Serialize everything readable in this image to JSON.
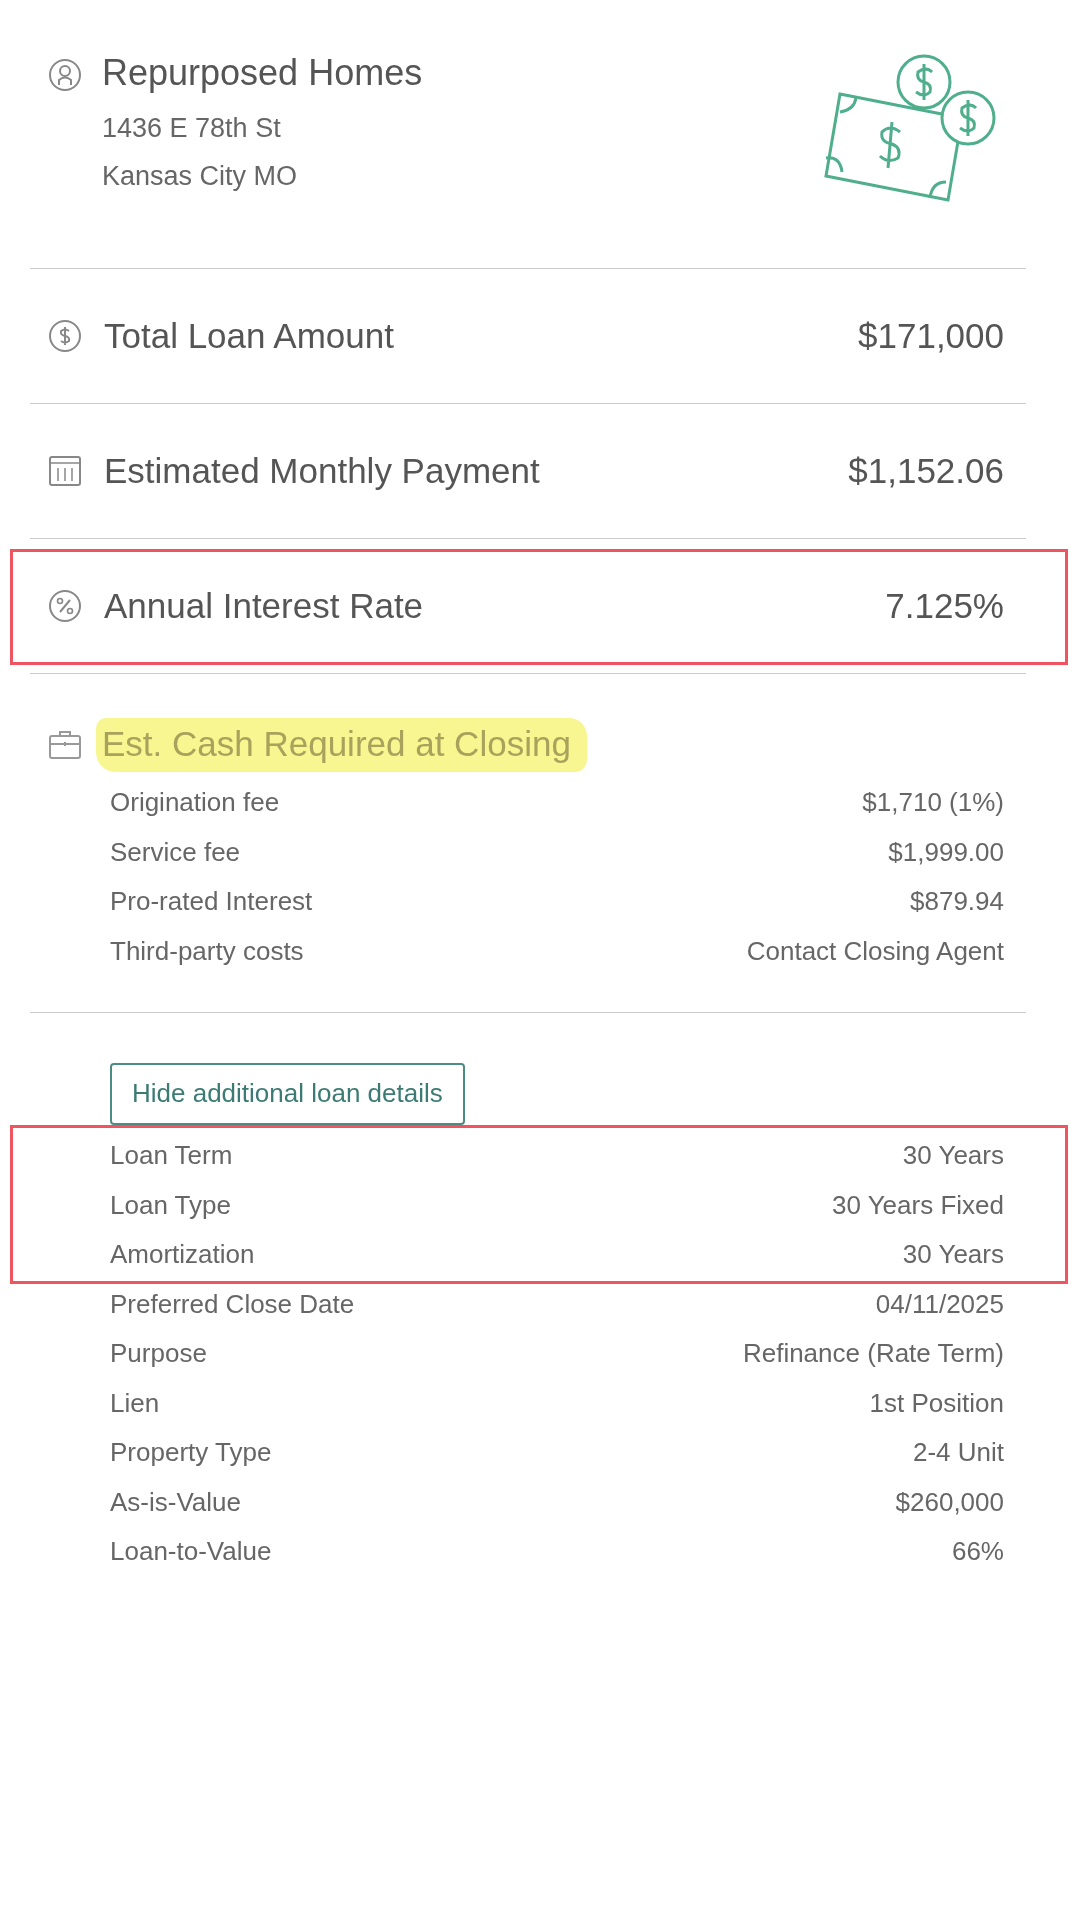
{
  "borrower": {
    "name": "Repurposed Homes",
    "address_lines": [
      "1436 E 78th St",
      "Kansas City MO"
    ]
  },
  "summary": [
    {
      "kind": "dollar",
      "label": "Total Loan Amount",
      "value": "$171,000",
      "outlined": false
    },
    {
      "kind": "calendar",
      "label": "Estimated Monthly Payment",
      "value": "$1,152.06",
      "outlined": false
    },
    {
      "kind": "percent",
      "label": "Annual Interest Rate",
      "value": "7.125%",
      "outlined": true
    }
  ],
  "closing": {
    "title": "Est. Cash Required at Closing",
    "highlighted": true,
    "rows": [
      {
        "label": "Origination fee",
        "value": "$1,710 (1%)"
      },
      {
        "label": "Service fee",
        "value": "$1,999.00"
      },
      {
        "label": "Pro-rated Interest",
        "value": "$879.94"
      },
      {
        "label": "Third-party costs",
        "value": "Contact Closing Agent"
      }
    ]
  },
  "toggle_button": "Hide additional loan details",
  "details": [
    {
      "outlined": true,
      "rows": [
        {
          "label": "Loan Term",
          "value": "30 Years"
        },
        {
          "label": "Loan Type",
          "value": "30 Years Fixed"
        },
        {
          "label": "Amortization",
          "value": "30 Years"
        }
      ]
    },
    {
      "outlined": false,
      "rows": [
        {
          "label": "Preferred Close Date",
          "value": "04/11/2025"
        },
        {
          "label": "Purpose",
          "value": "Refinance (Rate Term)"
        },
        {
          "label": "Lien",
          "value": "1st Position"
        },
        {
          "label": "Property Type",
          "value": "2-4 Unit"
        },
        {
          "label": "As-is-Value",
          "value": "$260,000"
        },
        {
          "label": "Loan-to-Value",
          "value": "66%"
        }
      ]
    }
  ]
}
